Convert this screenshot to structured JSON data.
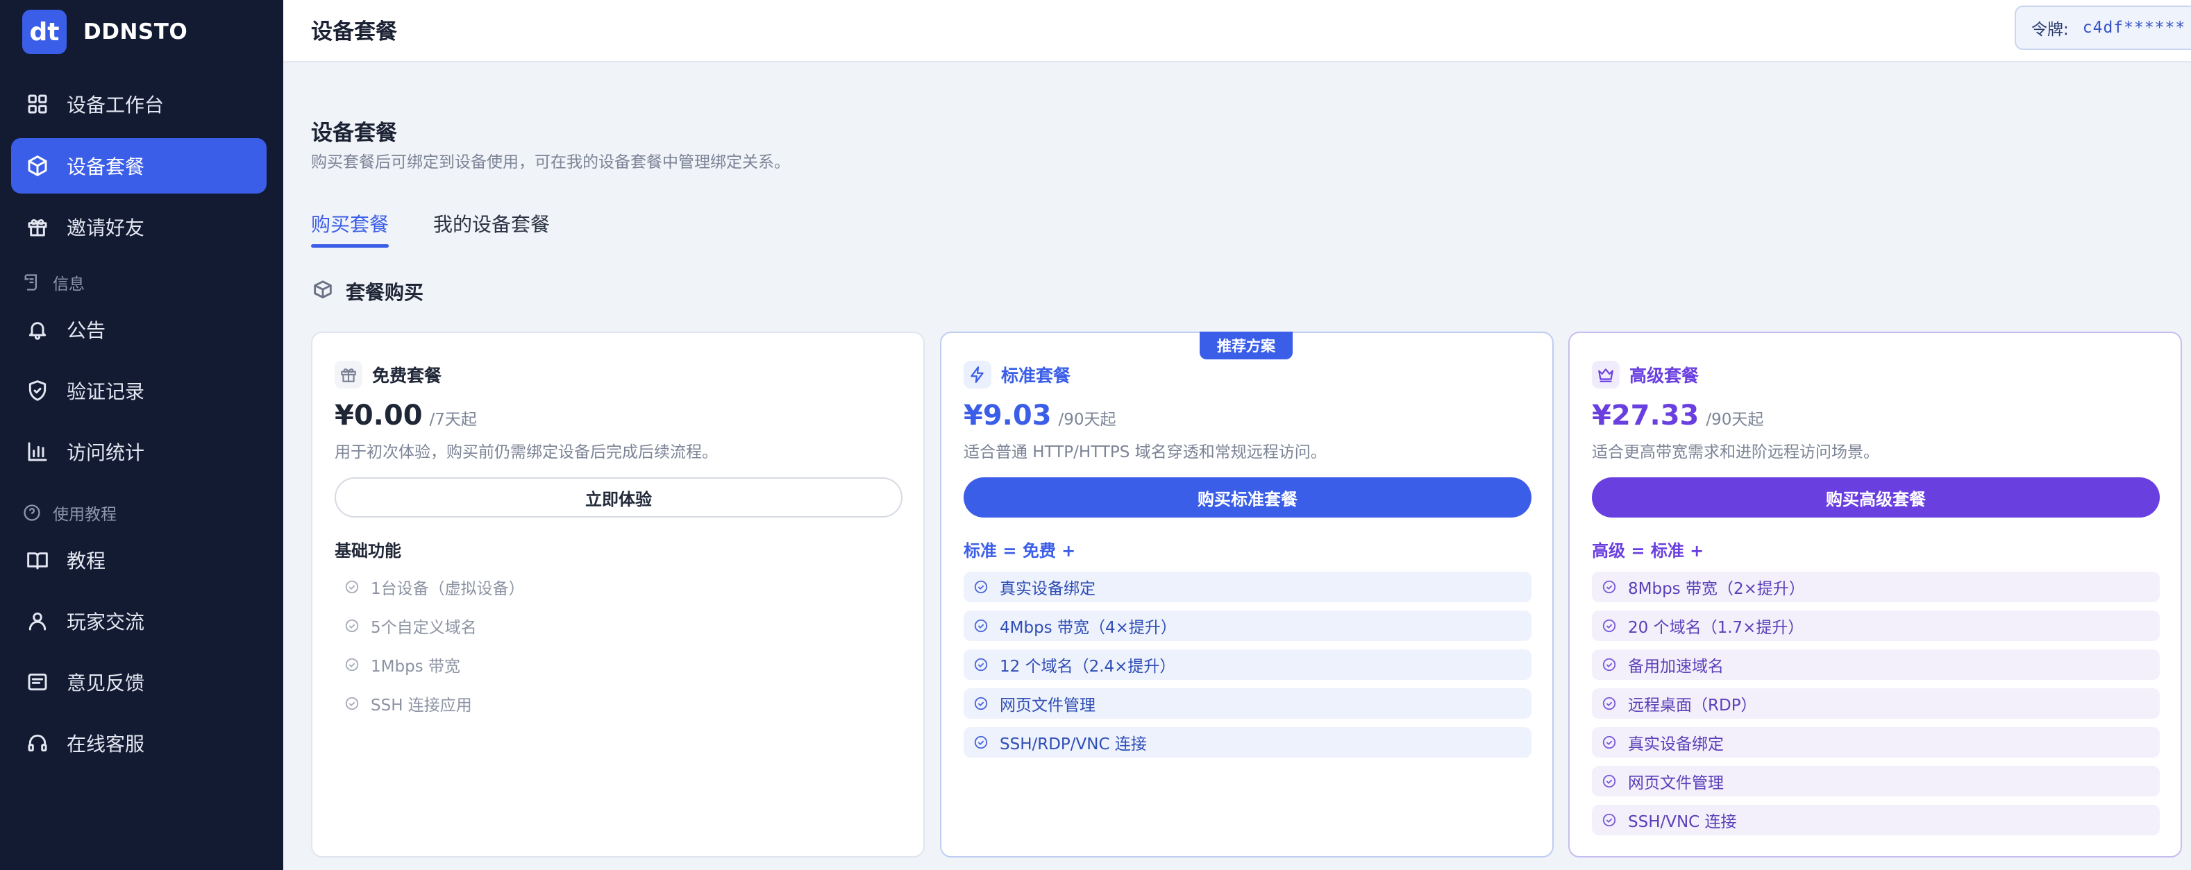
{
  "brand": {
    "name": "DDNSTO",
    "logo_text": "dt"
  },
  "sidebar": {
    "items": [
      {
        "label": "设备工作台",
        "icon": "dashboard-icon"
      },
      {
        "label": "设备套餐",
        "icon": "box-icon",
        "active": true
      },
      {
        "label": "邀请好友",
        "icon": "gift-icon"
      }
    ],
    "section_info": "信息",
    "info_items": [
      {
        "label": "公告",
        "icon": "bell-icon"
      },
      {
        "label": "验证记录",
        "icon": "shield-icon"
      },
      {
        "label": "访问统计",
        "icon": "bar-chart-icon"
      }
    ],
    "section_tutorial": "使用教程",
    "tutorial_items": [
      {
        "label": "教程",
        "icon": "book-icon"
      },
      {
        "label": "玩家交流",
        "icon": "user-icon"
      },
      {
        "label": "意见反馈",
        "icon": "feedback-icon"
      },
      {
        "label": "在线客服",
        "icon": "headset-icon"
      }
    ]
  },
  "header": {
    "title": "设备套餐",
    "token_label": "令牌:",
    "token_value": "c4df******"
  },
  "main": {
    "title": "设备套餐",
    "description": "购买套餐后可绑定到设备使用，可在我的设备套餐中管理绑定关系。",
    "tabs": [
      {
        "label": "购买套餐",
        "active": true
      },
      {
        "label": "我的设备套餐",
        "active": false
      }
    ],
    "section_title": "套餐购买"
  },
  "plans": [
    {
      "name": "免费套餐",
      "price": "¥0.00",
      "period": "/7天起",
      "description": "用于初次体验，购买前仍需绑定设备后完成后续流程。",
      "button": "立即体验",
      "features_title": "基础功能",
      "features": [
        "1台设备（虚拟设备）",
        "5个自定义域名",
        "1Mbps 带宽",
        "SSH 连接应用"
      ],
      "accent": "#1f2636"
    },
    {
      "name": "标准套餐",
      "badge": "推荐方案",
      "price": "¥9.03",
      "period": "/90天起",
      "description": "适合普通 HTTP/HTTPS 域名穿透和常规远程访问。",
      "button": "购买标准套餐",
      "features_title": "标准 = 免费 +",
      "features": [
        "真实设备绑定",
        "4Mbps 带宽（4×提升）",
        "12 个域名（2.4×提升）",
        "网页文件管理",
        "SSH/RDP/VNC 连接"
      ],
      "accent": "#3b5ee8"
    },
    {
      "name": "高级套餐",
      "price": "¥27.33",
      "period": "/90天起",
      "description": "适合更高带宽需求和进阶远程访问场景。",
      "button": "购买高级套餐",
      "features_title": "高级 = 标准 +",
      "features": [
        "8Mbps 带宽（2×提升）",
        "20 个域名（1.7×提升）",
        "备用加速域名",
        "远程桌面（RDP）",
        "真实设备绑定",
        "网页文件管理",
        "SSH/VNC 连接"
      ],
      "accent": "#6a3fe0"
    }
  ]
}
